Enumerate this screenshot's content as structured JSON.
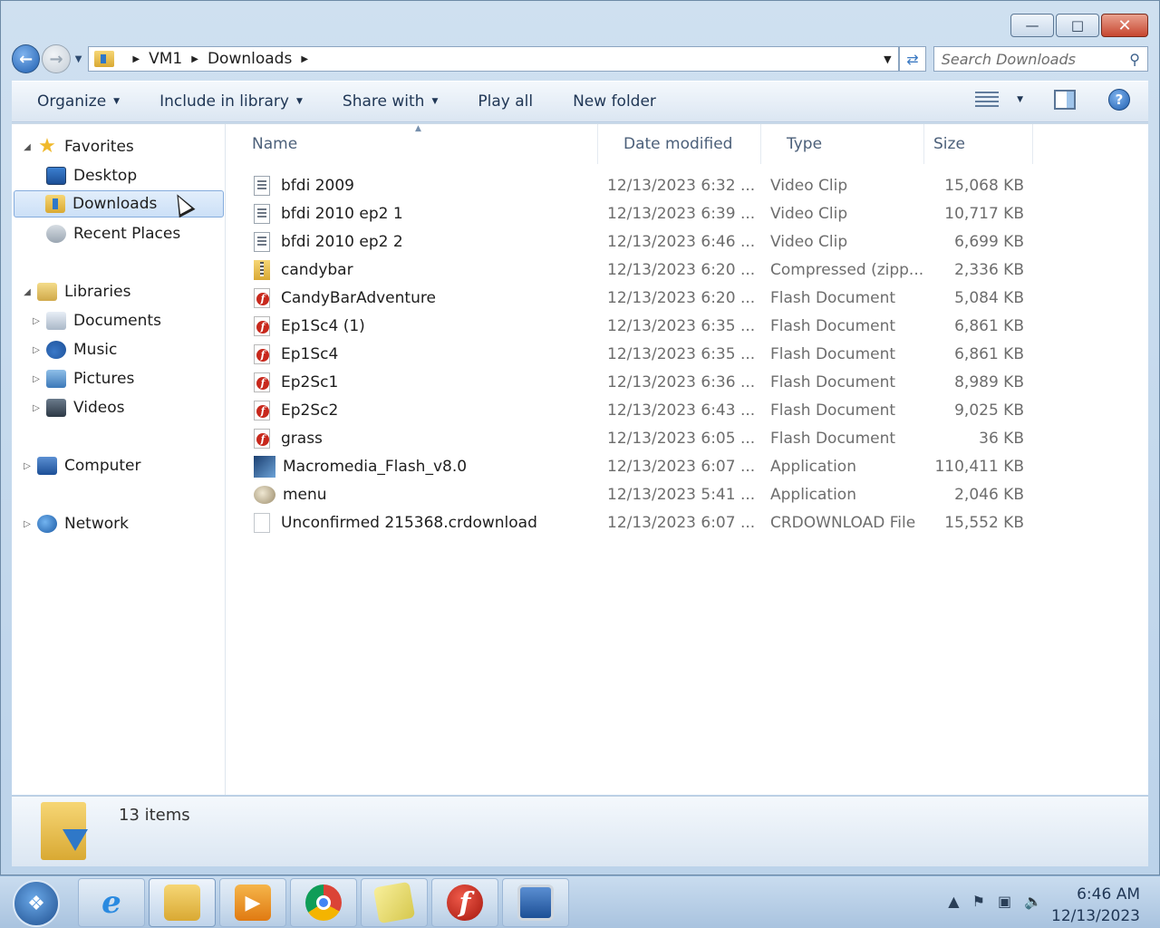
{
  "window": {
    "caption_buttons": {
      "minimize": "—",
      "maximize": "□",
      "close": "✕"
    }
  },
  "address": {
    "crumbs": [
      "VM1",
      "Downloads"
    ],
    "search_placeholder": "Search Downloads"
  },
  "toolbar": {
    "organize": "Organize",
    "include": "Include in library",
    "share": "Share with",
    "play_all": "Play all",
    "new_folder": "New folder"
  },
  "nav": {
    "favorites": "Favorites",
    "desktop": "Desktop",
    "downloads": "Downloads",
    "recent": "Recent Places",
    "libraries": "Libraries",
    "documents": "Documents",
    "music": "Music",
    "pictures": "Pictures",
    "videos": "Videos",
    "computer": "Computer",
    "network": "Network"
  },
  "columns": {
    "name": "Name",
    "date": "Date modified",
    "type": "Type",
    "size": "Size"
  },
  "files": [
    {
      "name": "bfdi 2009",
      "date": "12/13/2023 6:32 ...",
      "type": "Video Clip",
      "size": "15,068 KB",
      "icon": "video"
    },
    {
      "name": "bfdi 2010 ep2 1",
      "date": "12/13/2023 6:39 ...",
      "type": "Video Clip",
      "size": "10,717 KB",
      "icon": "video"
    },
    {
      "name": "bfdi 2010 ep2 2",
      "date": "12/13/2023 6:46 ...",
      "type": "Video Clip",
      "size": "6,699 KB",
      "icon": "video"
    },
    {
      "name": "candybar",
      "date": "12/13/2023 6:20 ...",
      "type": "Compressed (zipp...",
      "size": "2,336 KB",
      "icon": "zip"
    },
    {
      "name": "CandyBarAdventure",
      "date": "12/13/2023 6:20 ...",
      "type": "Flash Document",
      "size": "5,084 KB",
      "icon": "flash"
    },
    {
      "name": "Ep1Sc4 (1)",
      "date": "12/13/2023 6:35 ...",
      "type": "Flash Document",
      "size": "6,861 KB",
      "icon": "flash"
    },
    {
      "name": "Ep1Sc4",
      "date": "12/13/2023 6:35 ...",
      "type": "Flash Document",
      "size": "6,861 KB",
      "icon": "flash"
    },
    {
      "name": "Ep2Sc1",
      "date": "12/13/2023 6:36 ...",
      "type": "Flash Document",
      "size": "8,989 KB",
      "icon": "flash"
    },
    {
      "name": "Ep2Sc2",
      "date": "12/13/2023 6:43 ...",
      "type": "Flash Document",
      "size": "9,025 KB",
      "icon": "flash"
    },
    {
      "name": "grass",
      "date": "12/13/2023 6:05 ...",
      "type": "Flash Document",
      "size": "36 KB",
      "icon": "flash"
    },
    {
      "name": "Macromedia_Flash_v8.0",
      "date": "12/13/2023 6:07 ...",
      "type": "Application",
      "size": "110,411 KB",
      "icon": "app"
    },
    {
      "name": "menu",
      "date": "12/13/2023 5:41 ...",
      "type": "Application",
      "size": "2,046 KB",
      "icon": "app2"
    },
    {
      "name": "Unconfirmed 215368.crdownload",
      "date": "12/13/2023 6:07 ...",
      "type": "CRDOWNLOAD File",
      "size": "15,552 KB",
      "icon": "blank"
    }
  ],
  "details": {
    "count": "13 items"
  },
  "taskbar": {
    "time": "6:46 AM",
    "date": "12/13/2023"
  }
}
